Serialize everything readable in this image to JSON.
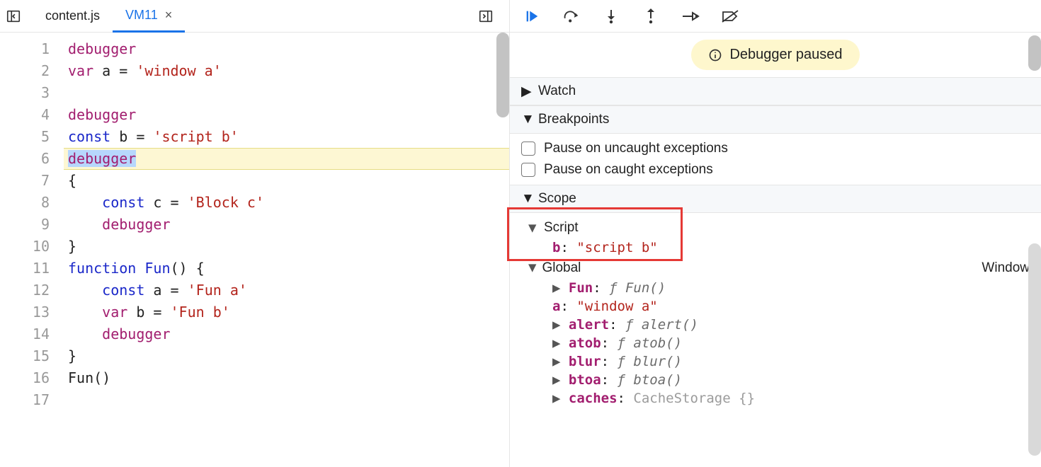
{
  "tabs": {
    "inactive": "content.js",
    "active": "VM11",
    "close_label": "×"
  },
  "code": {
    "line_count": 17,
    "highlight_line": 6,
    "lines": [
      {
        "tokens": [
          {
            "t": "debugger",
            "c": "kw"
          }
        ]
      },
      {
        "tokens": [
          {
            "t": "var",
            "c": "kw"
          },
          {
            "t": " a = ",
            "c": ""
          },
          {
            "t": "'window a'",
            "c": "str"
          }
        ]
      },
      {
        "tokens": []
      },
      {
        "tokens": [
          {
            "t": "debugger",
            "c": "kw"
          }
        ]
      },
      {
        "tokens": [
          {
            "t": "const",
            "c": "kw2"
          },
          {
            "t": " b = ",
            "c": ""
          },
          {
            "t": "'script b'",
            "c": "str"
          }
        ]
      },
      {
        "tokens": [
          {
            "t": "debugger",
            "c": "kw",
            "sel": true
          }
        ]
      },
      {
        "tokens": [
          {
            "t": "{",
            "c": ""
          }
        ]
      },
      {
        "tokens": [
          {
            "t": "    ",
            "c": ""
          },
          {
            "t": "const",
            "c": "kw2"
          },
          {
            "t": " c = ",
            "c": ""
          },
          {
            "t": "'Block c'",
            "c": "str"
          }
        ]
      },
      {
        "tokens": [
          {
            "t": "    ",
            "c": ""
          },
          {
            "t": "debugger",
            "c": "kw"
          }
        ]
      },
      {
        "tokens": [
          {
            "t": "}",
            "c": ""
          }
        ]
      },
      {
        "tokens": [
          {
            "t": "function",
            "c": "kw2"
          },
          {
            "t": " ",
            "c": ""
          },
          {
            "t": "Fun",
            "c": "fn"
          },
          {
            "t": "() {",
            "c": ""
          }
        ]
      },
      {
        "tokens": [
          {
            "t": "    ",
            "c": ""
          },
          {
            "t": "const",
            "c": "kw2"
          },
          {
            "t": " a = ",
            "c": ""
          },
          {
            "t": "'Fun a'",
            "c": "str"
          }
        ]
      },
      {
        "tokens": [
          {
            "t": "    ",
            "c": ""
          },
          {
            "t": "var",
            "c": "kw"
          },
          {
            "t": " b = ",
            "c": ""
          },
          {
            "t": "'Fun b'",
            "c": "str"
          }
        ]
      },
      {
        "tokens": [
          {
            "t": "    ",
            "c": ""
          },
          {
            "t": "debugger",
            "c": "kw"
          }
        ]
      },
      {
        "tokens": [
          {
            "t": "}",
            "c": ""
          }
        ]
      },
      {
        "tokens": [
          {
            "t": "Fun()",
            "c": ""
          }
        ]
      },
      {
        "tokens": []
      }
    ]
  },
  "status": "Debugger paused",
  "sections": {
    "watch": "Watch",
    "breakpoints": "Breakpoints",
    "bp_uncaught": "Pause on uncaught exceptions",
    "bp_caught": "Pause on caught exceptions",
    "scope": "Scope"
  },
  "scope": {
    "script_label": "Script",
    "script_prop": {
      "name": "b",
      "sep": ": ",
      "value": "\"script b\""
    },
    "global_label": "Global",
    "global_type": "Window",
    "global_props": [
      {
        "kind": "func",
        "name": "Fun",
        "sep": ": ",
        "fsym": "ƒ ",
        "sig": "Fun()",
        "expand": true
      },
      {
        "kind": "str",
        "name": "a",
        "sep": ": ",
        "value": "\"window a\"",
        "expand": false
      },
      {
        "kind": "func",
        "name": "alert",
        "sep": ": ",
        "fsym": "ƒ ",
        "sig": "alert()",
        "expand": true
      },
      {
        "kind": "func",
        "name": "atob",
        "sep": ": ",
        "fsym": "ƒ ",
        "sig": "atob()",
        "expand": true
      },
      {
        "kind": "func",
        "name": "blur",
        "sep": ": ",
        "fsym": "ƒ ",
        "sig": "blur()",
        "expand": true
      },
      {
        "kind": "func",
        "name": "btoa",
        "sep": ": ",
        "fsym": "ƒ ",
        "sig": "btoa()",
        "expand": true
      },
      {
        "kind": "type",
        "name": "caches",
        "sep": ": ",
        "value": "CacheStorage {}",
        "expand": true
      }
    ]
  }
}
